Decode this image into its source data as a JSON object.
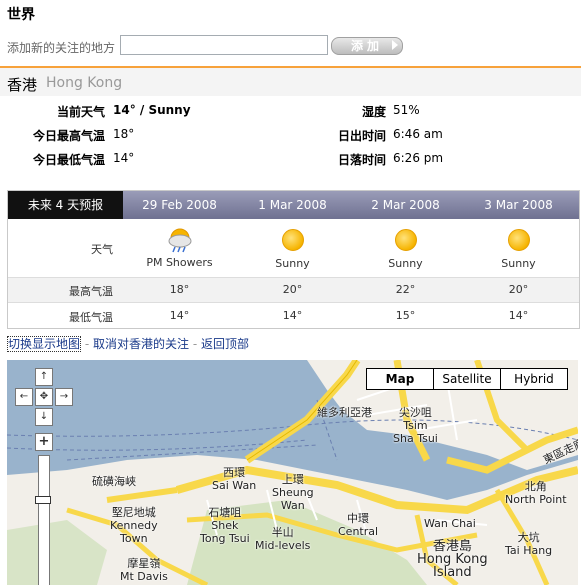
{
  "page_title": "世界",
  "add_location": {
    "label": "添加新的关注的地方",
    "input_value": "",
    "button_label": "添加"
  },
  "city": {
    "name_zh": "香港",
    "name_en": "Hong Kong"
  },
  "current": {
    "condition_label": "当前天气",
    "condition_value": "14° / Sunny",
    "high_label": "今日最高气温",
    "high_value": "18°",
    "low_label": "今日最低气温",
    "low_value": "14°",
    "humidity_label": "湿度",
    "humidity_value": "51%",
    "sunrise_label": "日出时间",
    "sunrise_value": "6:46 am",
    "sunset_label": "日落时间",
    "sunset_value": "6:26 pm"
  },
  "forecast": {
    "header": "未来 4 天预报",
    "row_weather": "天气",
    "row_high": "最高气温",
    "row_low": "最低气温",
    "days": [
      {
        "date": "29 Feb 2008",
        "condition": "PM Showers",
        "icon": "pm-showers-icon",
        "high": "18°",
        "low": "14°"
      },
      {
        "date": "1 Mar 2008",
        "condition": "Sunny",
        "icon": "sunny-icon",
        "high": "20°",
        "low": "14°"
      },
      {
        "date": "2 Mar 2008",
        "condition": "Sunny",
        "icon": "sunny-icon",
        "high": "22°",
        "low": "15°"
      },
      {
        "date": "3 Mar 2008",
        "condition": "Sunny",
        "icon": "sunny-icon",
        "high": "20°",
        "low": "14°"
      }
    ]
  },
  "links": {
    "toggle_map": "切换显示地图",
    "unfollow": "取消对香港的关注",
    "back_top": "返回顶部",
    "separator": "-"
  },
  "map": {
    "types": [
      "Map",
      "Satellite",
      "Hybrid"
    ],
    "selected_type": "Map",
    "controls": {
      "up": "↑",
      "down": "↓",
      "left": "←",
      "right": "→",
      "center": "✥",
      "zoom_in": "+"
    },
    "labels": {
      "victoria": "維多利亞港",
      "tst": "尖沙咀\nTsim\nSha Tsui",
      "sai_wan": "西環\nSai Wan",
      "sheung_wan": "上環\nSheung\nWan",
      "kennedy": "堅尼地城\nKennedy\nTown",
      "shek_tong": "石塘咀\nShek\nTong Tsui",
      "mid_levels": "半山\nMid-levels",
      "central": "中環\nCentral",
      "wan_chai": "Wan Chai",
      "hk_island": "香港島\nHong Kong\nIsland",
      "north_point": "北角\nNorth Point",
      "tai_hang": "大坑\nTai Hang",
      "mt_davis": "摩星嶺\nMt Davis",
      "sulphur": "硫磺海峽",
      "east_corridor": "東區走廊"
    }
  },
  "colors": {
    "accent_orange": "#f7a23b",
    "link_blue": "#1a3a8a",
    "header_dark": "#111111"
  }
}
